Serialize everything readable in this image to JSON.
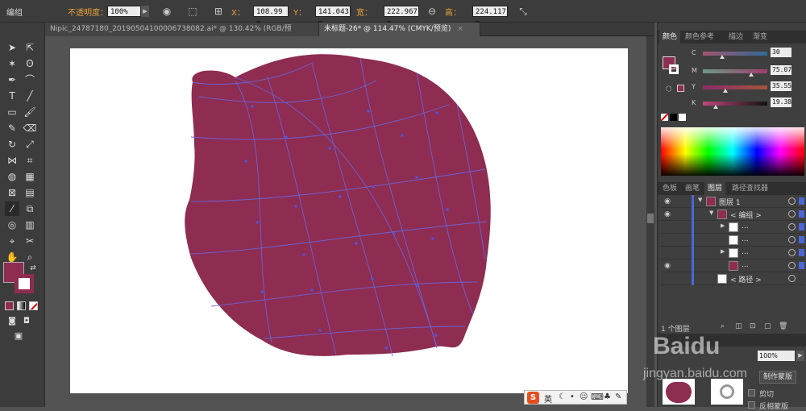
{
  "control_bar": {
    "selection_label": "编组",
    "opacity_label": "不透明度：",
    "opacity_value": "100%",
    "x_label": "X：",
    "x_value": "108.99 m",
    "y_label": "Y：",
    "y_value": "141.043 m",
    "w_label": "宽：",
    "w_value": "222.967 m",
    "h_label": "高：",
    "h_value": "224.117 m"
  },
  "document_tabs": [
    {
      "label": "Nipic_24787180_20190504100006738082.ai* @ 130.42% (RGB/预览)",
      "close": "×"
    },
    {
      "label": "未标题-26* @ 114.47% (CMYK/预览)",
      "close": "×"
    }
  ],
  "colors": {
    "fill": "#8e2c52",
    "mesh_line": "#6b63d6",
    "mesh_point": "#4d57e0",
    "accent": "#4a66d8"
  },
  "color_panel": {
    "tabs": [
      "颜色",
      "颜色参考",
      "描边",
      "渐变"
    ],
    "channels": [
      {
        "label": "C",
        "value": "30"
      },
      {
        "label": "M",
        "value": "75.07"
      },
      {
        "label": "Y",
        "value": "35.55"
      },
      {
        "label": "K",
        "value": "19.38"
      }
    ],
    "levels": {
      "C": 0.3,
      "M": 0.7507,
      "Y": 0.3555,
      "K": 0.1938
    }
  },
  "layers_panel": {
    "tabs": [
      "色板",
      "画笔",
      "图层",
      "路径查找器"
    ],
    "rows": [
      {
        "name": "图层 1",
        "eye": true,
        "indent": 0,
        "twirl": "▼"
      },
      {
        "name": "< 编组 >",
        "eye": true,
        "indent": 1,
        "twirl": "▼"
      },
      {
        "name": "...",
        "eye": false,
        "indent": 2,
        "twirl": "▶"
      },
      {
        "name": "...",
        "eye": false,
        "indent": 2,
        "twirl": ""
      },
      {
        "name": "...",
        "eye": false,
        "indent": 2,
        "twirl": "▶"
      },
      {
        "name": "...",
        "eye": true,
        "indent": 2,
        "twirl": ""
      },
      {
        "name": "< 路径 >",
        "eye": false,
        "indent": 1,
        "twirl": ""
      }
    ],
    "footer_count": "1 个图层"
  },
  "transparency_panel": {
    "opacity_value": "100%",
    "make_mask_button": "制作蒙版",
    "clip_label": "剪切",
    "invert_label": "反相蒙版"
  },
  "ime_bar": {
    "logo": "S",
    "lang": "英"
  },
  "watermark": "Baidu 经验 jingyan.baidu.com"
}
